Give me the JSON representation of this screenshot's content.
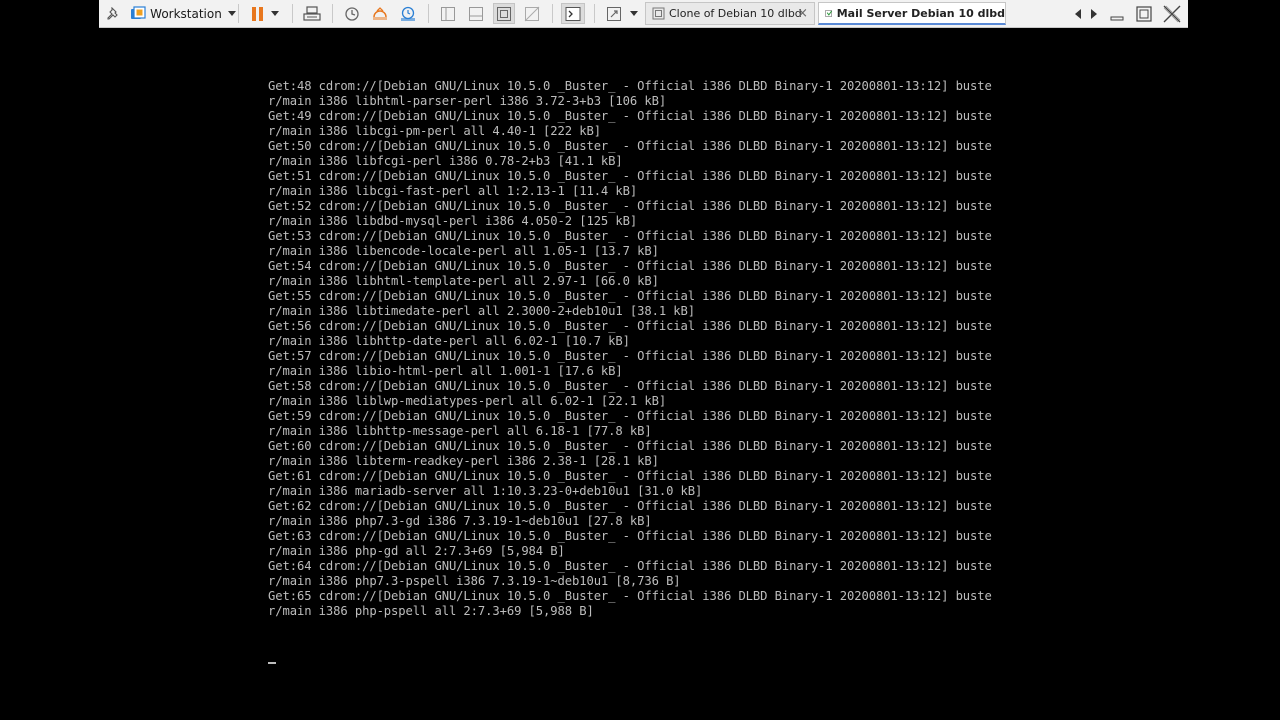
{
  "toolbar": {
    "workstation_label": "Workstation",
    "tabs": [
      {
        "label": "Clone of Debian 10 dlbd",
        "active": false,
        "close": "×"
      },
      {
        "label": "Mail Server Debian 10 dlbd",
        "active": true,
        "close": "×"
      }
    ],
    "icons": [
      "pin-icon",
      "vm-library-icon",
      "pause-icon",
      "send-ctrl-alt-del-icon",
      "snapshot-icon",
      "revert-snapshot-icon",
      "snapshot-manager-icon",
      "sidebar-icon",
      "thumbnail-bar-icon",
      "full-screen-icon",
      "unity-icon",
      "console-view-icon",
      "stretch-icon",
      "scroll-left-icon",
      "scroll-right-icon",
      "minimize-icon",
      "restore-icon",
      "close-icon"
    ],
    "accent_color": "#e8771e"
  },
  "console": {
    "lines": [
      "Get:48 cdrom://[Debian GNU/Linux 10.5.0 _Buster_ - Official i386 DLBD Binary-1 20200801-13:12] buste",
      "r/main i386 libhtml-parser-perl i386 3.72-3+b3 [106 kB]",
      "Get:49 cdrom://[Debian GNU/Linux 10.5.0 _Buster_ - Official i386 DLBD Binary-1 20200801-13:12] buste",
      "r/main i386 libcgi-pm-perl all 4.40-1 [222 kB]",
      "Get:50 cdrom://[Debian GNU/Linux 10.5.0 _Buster_ - Official i386 DLBD Binary-1 20200801-13:12] buste",
      "r/main i386 libfcgi-perl i386 0.78-2+b3 [41.1 kB]",
      "Get:51 cdrom://[Debian GNU/Linux 10.5.0 _Buster_ - Official i386 DLBD Binary-1 20200801-13:12] buste",
      "r/main i386 libcgi-fast-perl all 1:2.13-1 [11.4 kB]",
      "Get:52 cdrom://[Debian GNU/Linux 10.5.0 _Buster_ - Official i386 DLBD Binary-1 20200801-13:12] buste",
      "r/main i386 libdbd-mysql-perl i386 4.050-2 [125 kB]",
      "Get:53 cdrom://[Debian GNU/Linux 10.5.0 _Buster_ - Official i386 DLBD Binary-1 20200801-13:12] buste",
      "r/main i386 libencode-locale-perl all 1.05-1 [13.7 kB]",
      "Get:54 cdrom://[Debian GNU/Linux 10.5.0 _Buster_ - Official i386 DLBD Binary-1 20200801-13:12] buste",
      "r/main i386 libhtml-template-perl all 2.97-1 [66.0 kB]",
      "Get:55 cdrom://[Debian GNU/Linux 10.5.0 _Buster_ - Official i386 DLBD Binary-1 20200801-13:12] buste",
      "r/main i386 libtimedate-perl all 2.3000-2+deb10u1 [38.1 kB]",
      "Get:56 cdrom://[Debian GNU/Linux 10.5.0 _Buster_ - Official i386 DLBD Binary-1 20200801-13:12] buste",
      "r/main i386 libhttp-date-perl all 6.02-1 [10.7 kB]",
      "Get:57 cdrom://[Debian GNU/Linux 10.5.0 _Buster_ - Official i386 DLBD Binary-1 20200801-13:12] buste",
      "r/main i386 libio-html-perl all 1.001-1 [17.6 kB]",
      "Get:58 cdrom://[Debian GNU/Linux 10.5.0 _Buster_ - Official i386 DLBD Binary-1 20200801-13:12] buste",
      "r/main i386 liblwp-mediatypes-perl all 6.02-1 [22.1 kB]",
      "Get:59 cdrom://[Debian GNU/Linux 10.5.0 _Buster_ - Official i386 DLBD Binary-1 20200801-13:12] buste",
      "r/main i386 libhttp-message-perl all 6.18-1 [77.8 kB]",
      "Get:60 cdrom://[Debian GNU/Linux 10.5.0 _Buster_ - Official i386 DLBD Binary-1 20200801-13:12] buste",
      "r/main i386 libterm-readkey-perl i386 2.38-1 [28.1 kB]",
      "Get:61 cdrom://[Debian GNU/Linux 10.5.0 _Buster_ - Official i386 DLBD Binary-1 20200801-13:12] buste",
      "r/main i386 mariadb-server all 1:10.3.23-0+deb10u1 [31.0 kB]",
      "Get:62 cdrom://[Debian GNU/Linux 10.5.0 _Buster_ - Official i386 DLBD Binary-1 20200801-13:12] buste",
      "r/main i386 php7.3-gd i386 7.3.19-1~deb10u1 [27.8 kB]",
      "Get:63 cdrom://[Debian GNU/Linux 10.5.0 _Buster_ - Official i386 DLBD Binary-1 20200801-13:12] buste",
      "r/main i386 php-gd all 2:7.3+69 [5,984 B]",
      "Get:64 cdrom://[Debian GNU/Linux 10.5.0 _Buster_ - Official i386 DLBD Binary-1 20200801-13:12] buste",
      "r/main i386 php7.3-pspell i386 7.3.19-1~deb10u1 [8,736 B]",
      "Get:65 cdrom://[Debian GNU/Linux 10.5.0 _Buster_ - Official i386 DLBD Binary-1 20200801-13:12] buste",
      "r/main i386 php-pspell all 2:7.3+69 [5,988 B]"
    ],
    "text_color": "#bdbdbd",
    "background_color": "#000000"
  }
}
